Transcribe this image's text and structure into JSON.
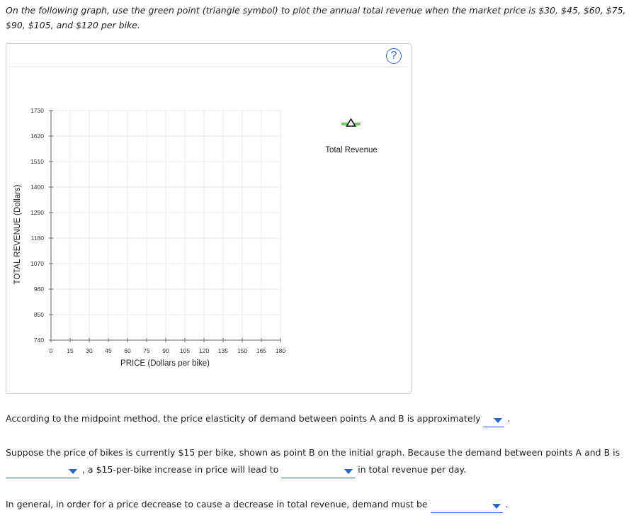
{
  "instructions": "On the following graph, use the green point (triangle symbol) to plot the annual total revenue when the market price is $30, $45, $60, $75, $90, $105, and $120 per bike.",
  "help_button": {
    "label": "?"
  },
  "legend": {
    "label": "Total Revenue",
    "symbol_color": "#7cc576",
    "icon": "triangle-icon"
  },
  "chart_data": {
    "type": "scatter",
    "xlabel": "PRICE (Dollars per bike)",
    "ylabel": "TOTAL REVENUE (Dollars)",
    "x_ticks": [
      0,
      15,
      30,
      45,
      60,
      75,
      90,
      105,
      120,
      135,
      150,
      165,
      180
    ],
    "y_ticks": [
      740,
      850,
      960,
      1070,
      1180,
      1290,
      1400,
      1510,
      1620,
      1730
    ],
    "xlim": [
      0,
      180
    ],
    "ylim": [
      740,
      1730
    ],
    "grid": true,
    "legend_position": "top-right",
    "series": []
  },
  "questions": {
    "q1": {
      "text_before": "According to the midpoint method, the price elasticity of demand between points A and B is approximately",
      "text_after": "."
    },
    "q2": {
      "text_before": "Suppose the price of bikes is currently $15 per bike, shown as point B on the initial graph. Because the demand between points A and B is",
      "text_middle": ", a $15-per-bike increase in price will lead to",
      "text_after": "in total revenue per day."
    },
    "q3": {
      "text_before": "In general, in order for a price decrease to cause a decrease in total revenue, demand must be",
      "text_after": "."
    }
  },
  "colors": {
    "accent": "#2b66c9",
    "grid": "#e8e8e8",
    "marker_green": "#7cc576"
  }
}
